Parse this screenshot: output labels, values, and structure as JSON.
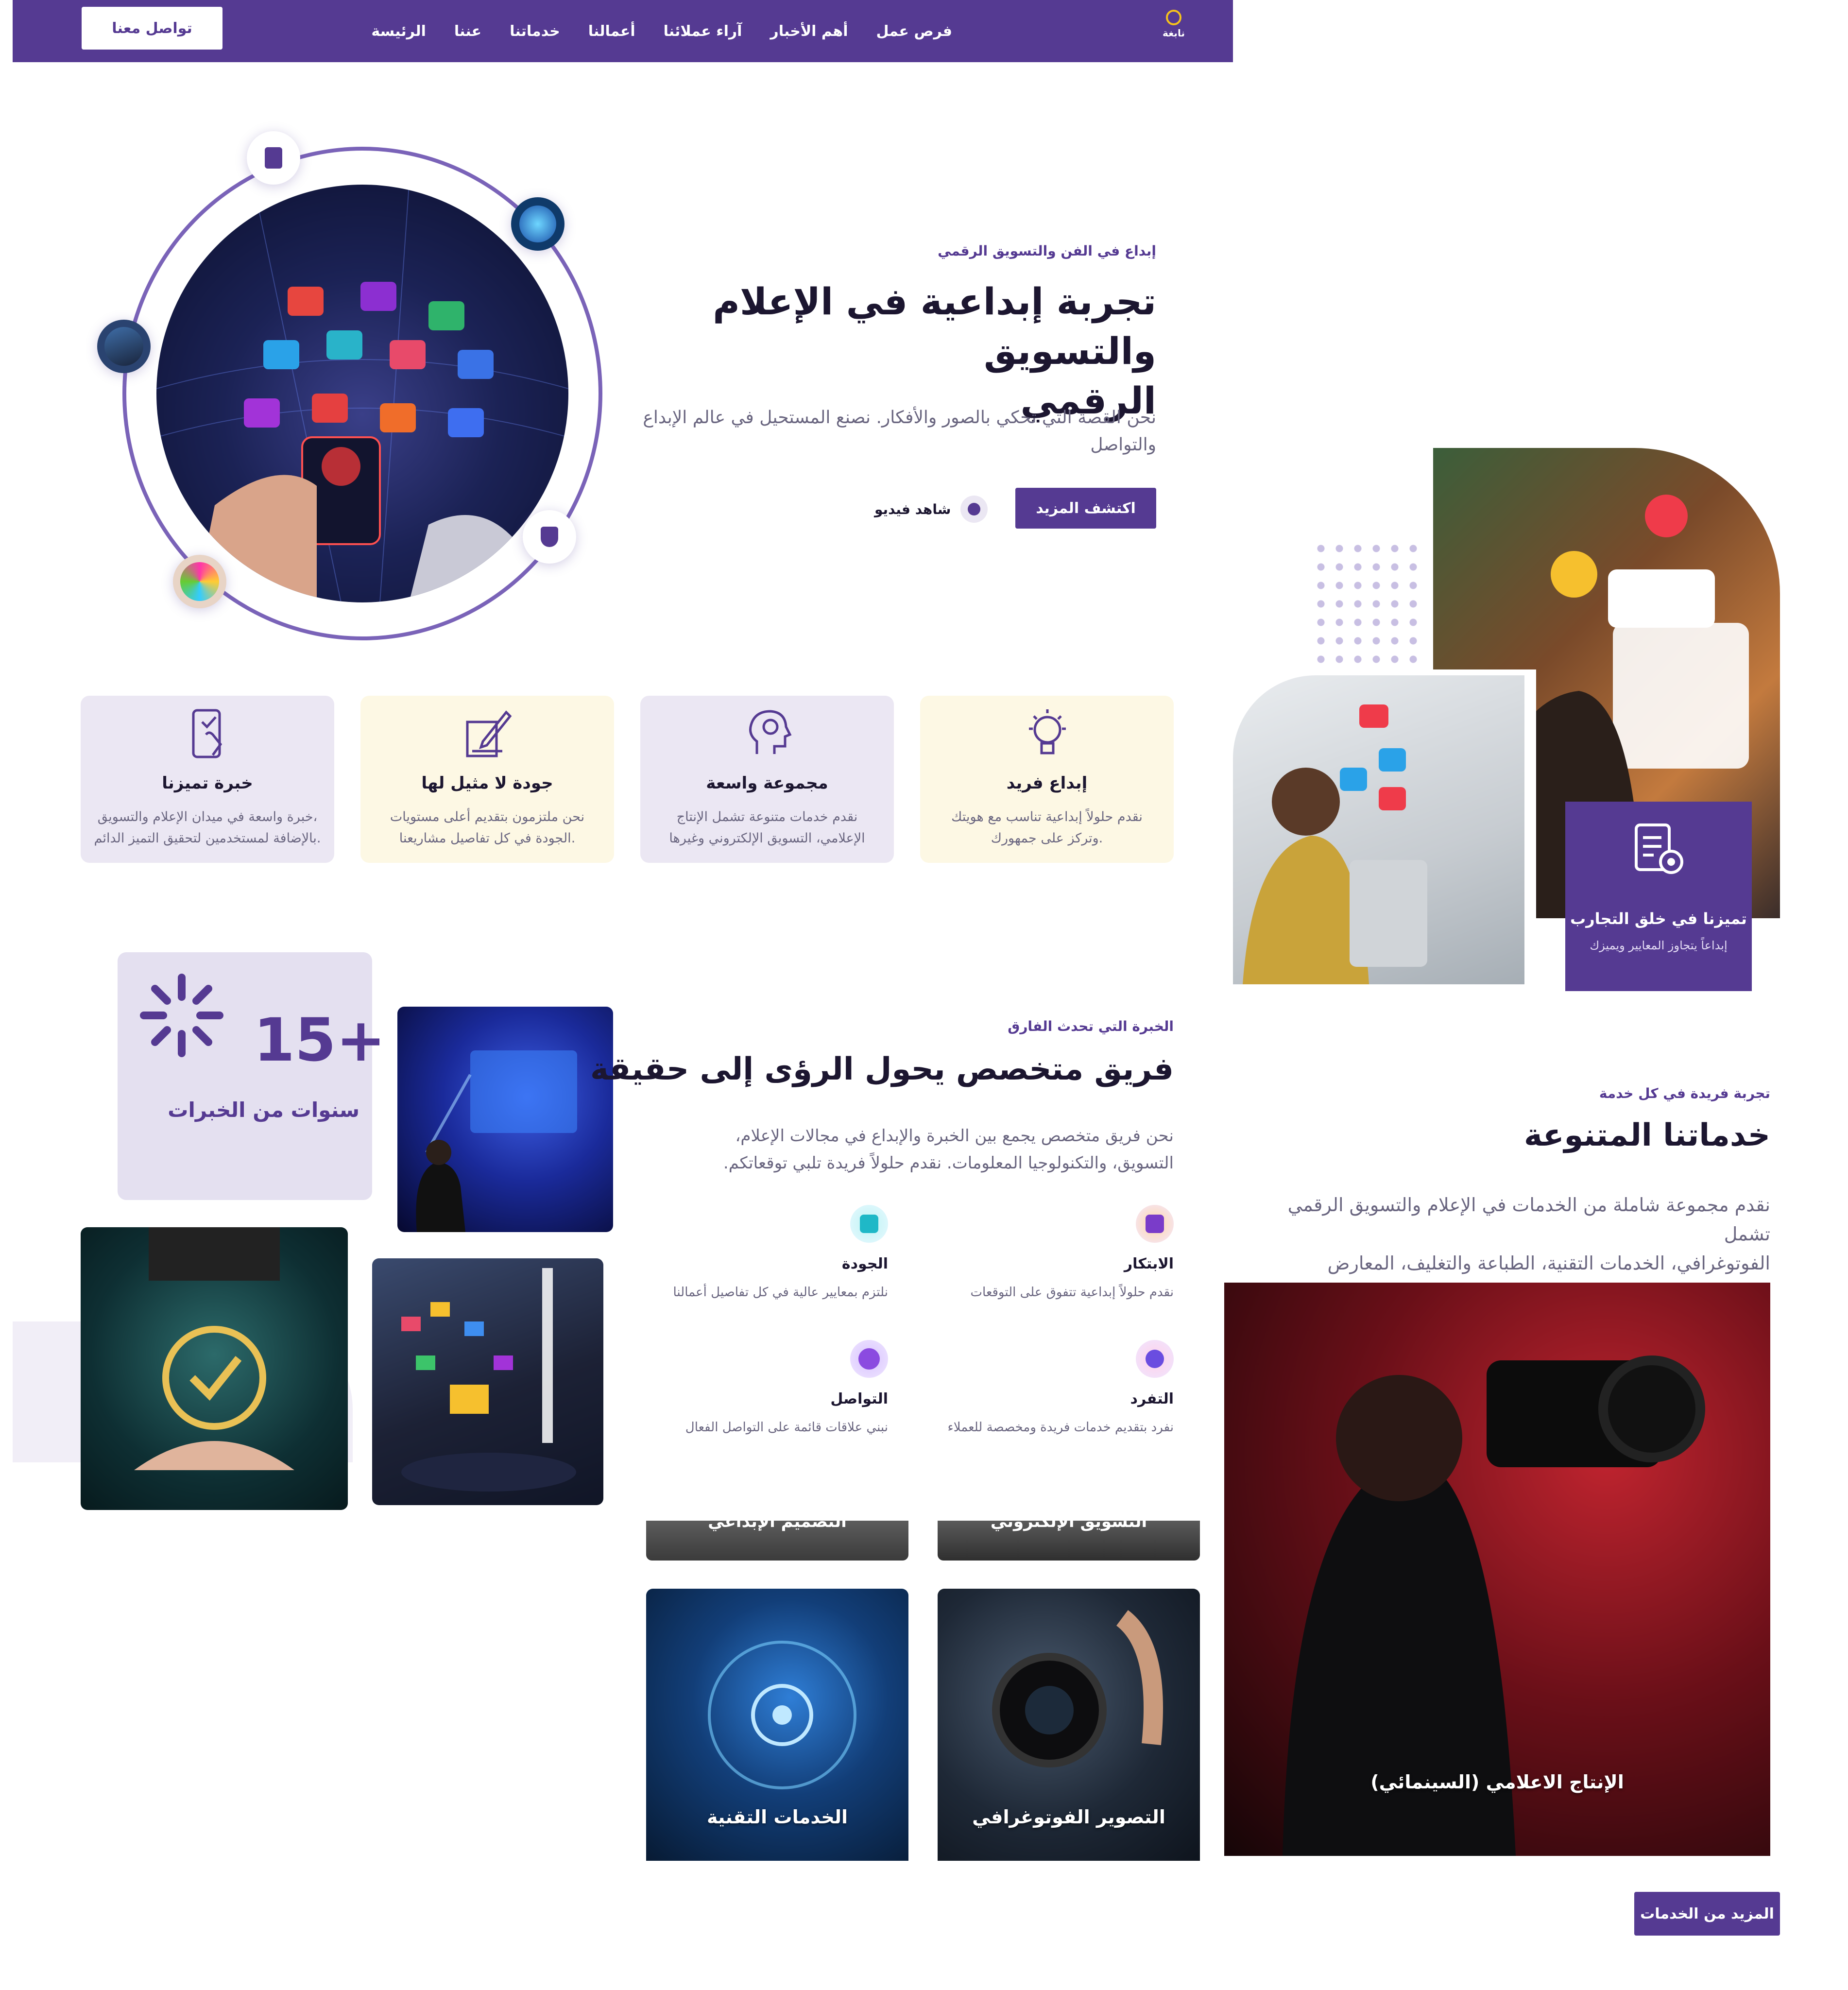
{
  "header": {
    "logo_text": "نابغة",
    "nav": [
      "الرئيسة",
      "عننا",
      "خدماتنا",
      "أعمالنا",
      "آراء عملائنا",
      "أهم الأخبار",
      "فرص عمل"
    ],
    "contact_button": "تواصل معنا"
  },
  "hero": {
    "eyebrow": "إبداع في الفن والتسويق الرقمي",
    "title_line1": "تجربة إبداعية في الإعلام والتسويق",
    "title_line2": "الرقمي",
    "description_line1": "نحن القصة التي تحكي بالصور والأفكار. نصنع المستحيل في عالم الإبداع",
    "description_line2": "والتواصل",
    "primary_button": "اكتشف المزيد",
    "video_link": "شاهد فيديو"
  },
  "features": [
    {
      "title": "إبداع فريد",
      "desc_line1": "نقدم حلولاً إبداعية تناسب مع هويتك",
      "desc_line2": "وتركز على جمهورك."
    },
    {
      "title": "مجموعة واسعة",
      "desc_line1": "نقدم خدمات متنوعة تشمل الإنتاج",
      "desc_line2": "الإعلامي، التسويق الإلكتروني وغيرها"
    },
    {
      "title": "جودة لا مثيل لها",
      "desc_line1": "نحن ملتزمون بتقديم أعلى مستويات",
      "desc_line2": "الجودة في كل تفاصيل مشاريعنا."
    },
    {
      "title": "خبرة تميزنا",
      "desc_line1": "خبرة واسعة في ميدان الإعلام والتسويق،",
      "desc_line2": "بالإضافة لمستخدمين لتحقيق التميز الدائم."
    }
  ],
  "about": {
    "stat_number": "15+",
    "stat_label": "سنوات من الخبرات",
    "eyebrow": "الخبرة التي تحدث الفارق",
    "title": "فريق متخصص يحول الرؤى إلى حقيقة",
    "description_line1": "نحن فريق متخصص يجمع بين الخبرة والإبداع في مجالات الإعلام،",
    "description_line2": "التسويق، والتكنولوجيا المعلومات. نقدم حلولاً فريدة تلبي توقعاتكم.",
    "values": [
      {
        "title": "الابتكار",
        "desc": "نقدم حلولاً إبداعية تتفوق على التوقعات"
      },
      {
        "title": "الجودة",
        "desc": "نلتزم بمعايير عالية في كل تفاصيل أعمالنا"
      },
      {
        "title": "التفرد",
        "desc": "نفرد بتقديم خدمات فريدة ومخصصة للعملاء"
      },
      {
        "title": "التواصل",
        "desc": "نبني علاقات قائمة على التواصل الفعال"
      }
    ]
  },
  "right_hero": {
    "badge_title": "تميزنا في خلق التجارب",
    "badge_desc": "إبداعاً يتجاوز المعايير ويميزك"
  },
  "services": {
    "eyebrow": "تجربة فريدة في كل خدمة",
    "title": "خدماتنا المتنوعة",
    "description_line1": "نقدم مجموعة شاملة من الخدمات في الإعلام والتسويق الرقمي تشمل",
    "description_line2": "الفوتوغرافي، الخدمات التقنية، الطباعة والتغليف، المعارض والمؤتمرات",
    "tiles": [
      "الإنتاج الاعلامي (السينمائي)",
      "الخدمات التقنية",
      "التصوير الفوتوغرافي"
    ],
    "cut_tiles": [
      "التصميم الإبداعي",
      "التسويق الإلكتروني"
    ],
    "more_button": "المزيد من الخدمات"
  },
  "colors": {
    "brand": "#553a92",
    "lavender": "#ebe7f3",
    "cream": "#fdf8e4"
  }
}
